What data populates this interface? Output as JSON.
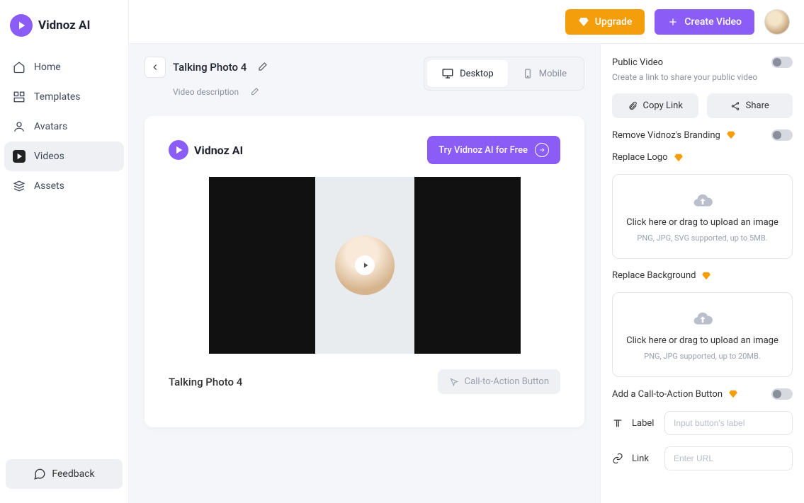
{
  "brand": {
    "name": "Vidnoz AI"
  },
  "sidebar": {
    "items": [
      {
        "label": "Home"
      },
      {
        "label": "Templates"
      },
      {
        "label": "Avatars"
      },
      {
        "label": "Videos"
      },
      {
        "label": "Assets"
      }
    ],
    "feedback": "Feedback"
  },
  "topbar": {
    "upgrade": "Upgrade",
    "create": "Create Video"
  },
  "editor": {
    "title": "Talking Photo 4",
    "description": "Video description",
    "view": {
      "desktop": "Desktop",
      "mobile": "Mobile"
    },
    "try_cta": "Try Vidnoz AI for Free",
    "preview_title": "Talking Photo 4",
    "cta_button": "Call-to-Action Button"
  },
  "panel": {
    "public_video": "Public Video",
    "public_sub": "Create a link to share your public video",
    "copy_link": "Copy Link",
    "share": "Share",
    "remove_branding": "Remove Vidnoz's Branding",
    "replace_logo": "Replace Logo",
    "upload_logo_text": "Click here or drag to upload an image",
    "upload_logo_sub": "PNG, JPG, SVG supported, up to 5MB.",
    "replace_bg": "Replace Background",
    "upload_bg_text": "Click here or drag to upload an image",
    "upload_bg_sub": "PNG, JPG supported, up to 20MB.",
    "add_cta": "Add a Call-to-Action Button",
    "label_label": "Label",
    "label_placeholder": "Input button's label",
    "link_label": "Link",
    "link_placeholder": "Enter URL"
  }
}
